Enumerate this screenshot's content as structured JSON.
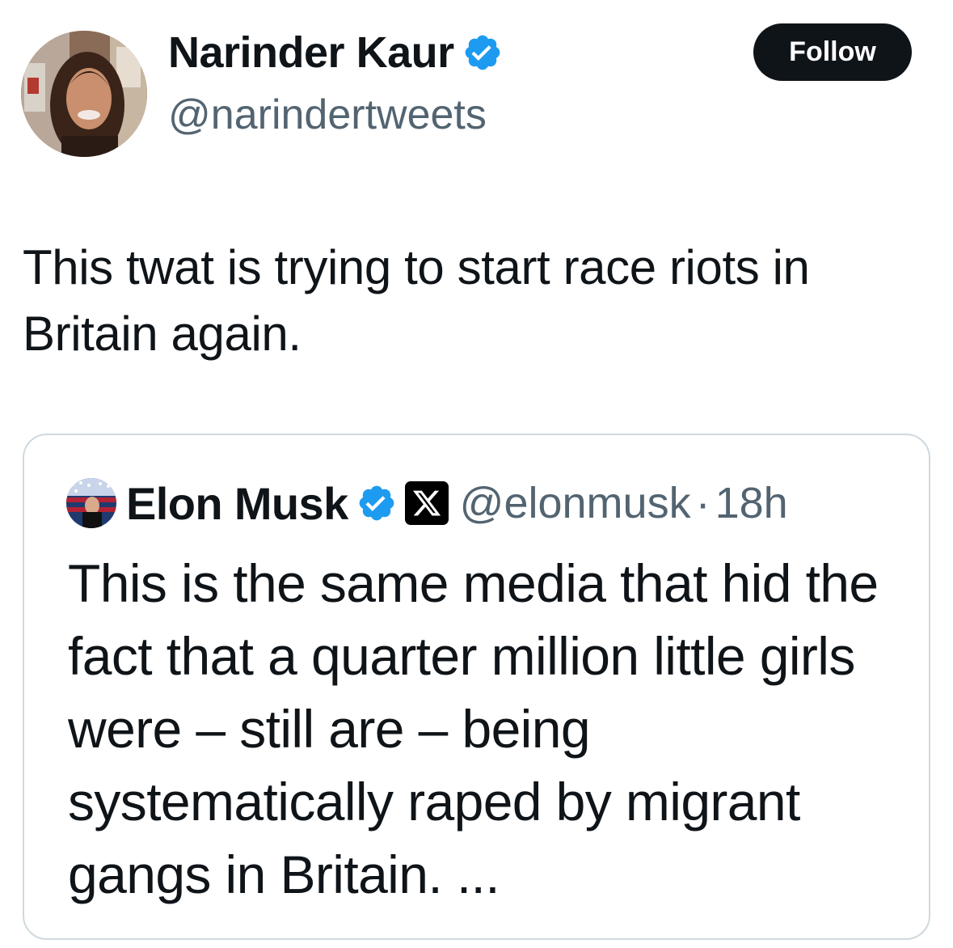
{
  "author": {
    "name": "Narinder Kaur",
    "handle": "@narindertweets",
    "verified": true,
    "avatar_icon": "profile-photo"
  },
  "follow_button": {
    "label": "Follow"
  },
  "tweet": {
    "text": "This twat is trying to start race riots in Britain again."
  },
  "quoted_tweet": {
    "author_name": "Elon Musk",
    "handle": "@elonmusk",
    "separator": "·",
    "time": "18h",
    "verified": true,
    "affiliate_badge_icon": "x-logo-icon",
    "text": "This is the same media that hid the fact that a quarter million little girls were – still are – being systematically raped by migrant gangs in Britain. ..."
  },
  "colors": {
    "text_primary": "#0f1419",
    "text_secondary": "#536471",
    "verified_blue": "#1d9bf0",
    "border": "#cfd9de",
    "button_bg": "#0f1419"
  }
}
